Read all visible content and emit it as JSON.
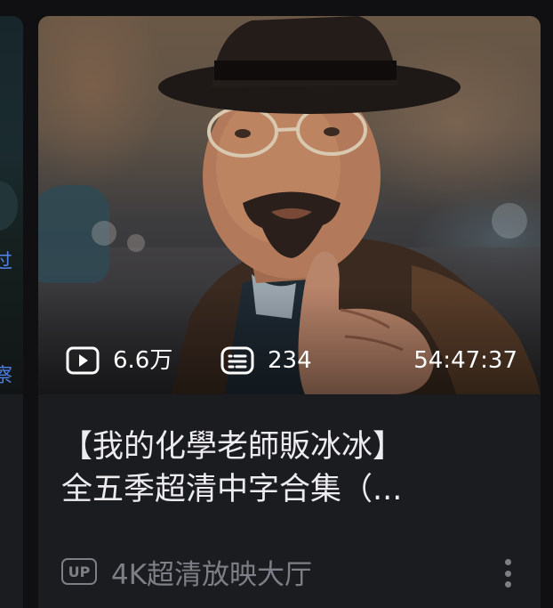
{
  "left_card": {
    "text_1": "过",
    "text_2": "察"
  },
  "video": {
    "views": "6.6万",
    "danmaku_count": "234",
    "duration": "54:47:37",
    "title_line_1": "【我的化學老師販冰冰】",
    "title_line_2": "全五季超清中字合集（...",
    "up_badge": "UP",
    "uploader": "4K超清放映大厅"
  },
  "icons": {
    "views": "play-icon",
    "danmaku": "danmaku-icon",
    "more": "more-vertical-icon"
  },
  "colors": {
    "background": "#101012",
    "card": "#1b1c20",
    "title_text": "#ececee",
    "meta_text": "#7e7f86",
    "left_card_text": "#4f7fe0"
  }
}
